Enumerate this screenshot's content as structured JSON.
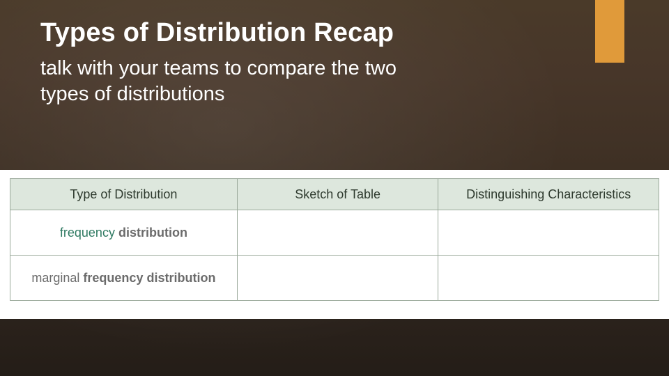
{
  "accent_color": "#e09a3a",
  "header": {
    "title": "Types of Distribution Recap",
    "subtitle": "talk with your teams to compare the two types of distributions"
  },
  "table": {
    "columns": {
      "c1": "Type of Distribution",
      "c2": "Sketch of Table",
      "c3": "Distinguishing Characteristics"
    },
    "rows": [
      {
        "label_w1": "frequency",
        "label_w2": "distribution",
        "sketch": "",
        "characteristics": ""
      },
      {
        "label_full_prefix": "marginal ",
        "label_full_bold": "frequency distribution",
        "sketch": "",
        "characteristics": ""
      }
    ]
  }
}
